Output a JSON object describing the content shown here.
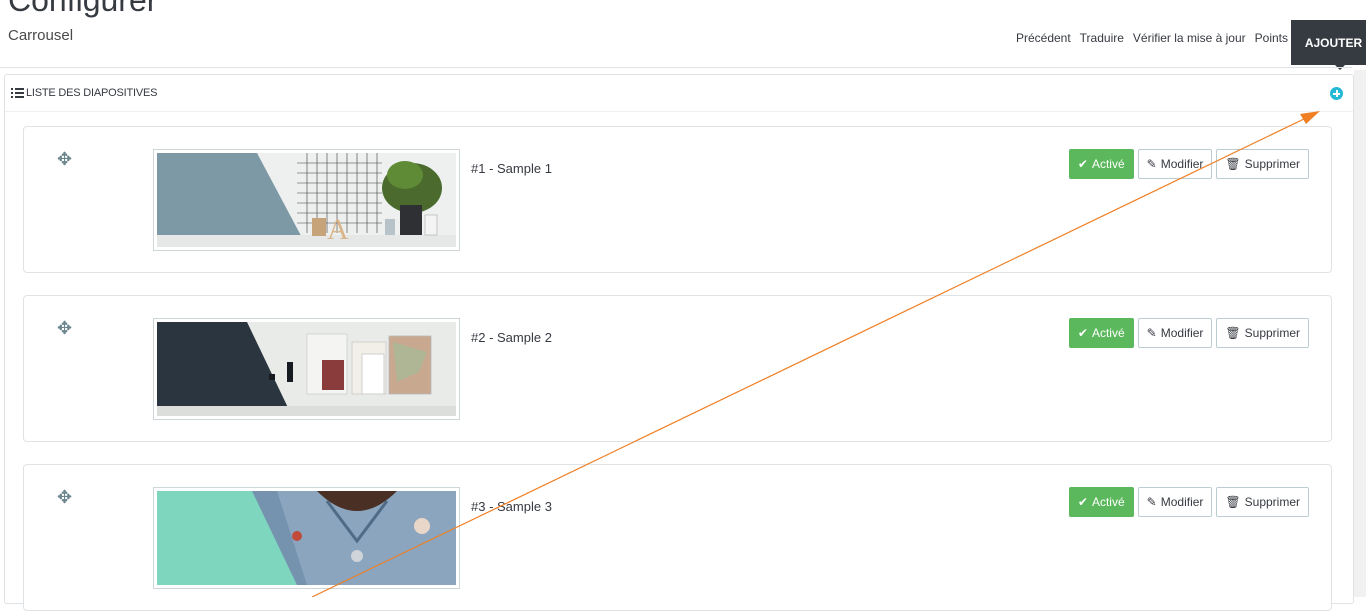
{
  "header": {
    "title": "Configurer",
    "breadcrumb": "Carrousel",
    "toolbar": [
      "Précédent",
      "Traduire",
      "Vérifier la mise à jour",
      "Points"
    ],
    "tooltip": "AJOUTER"
  },
  "panel": {
    "heading": "LISTE DES DIAPOSITIVES",
    "add_icon": "plus-circle-icon"
  },
  "slides": [
    {
      "title": "#1 - Sample 1",
      "status": "Activé",
      "edit": "Modifier",
      "delete": "Supprimer"
    },
    {
      "title": "#2 - Sample 2",
      "status": "Activé",
      "edit": "Modifier",
      "delete": "Supprimer"
    },
    {
      "title": "#3 - Sample 3",
      "status": "Activé",
      "edit": "Modifier",
      "delete": "Supprimer"
    }
  ],
  "colors": {
    "accent": "#25b9d7",
    "success": "#5cb85c",
    "annotation_arrow": "#f07f24",
    "thumb1": "#7d99a6",
    "thumb2": "#2a3540",
    "thumb3": "#7fd6bf"
  }
}
